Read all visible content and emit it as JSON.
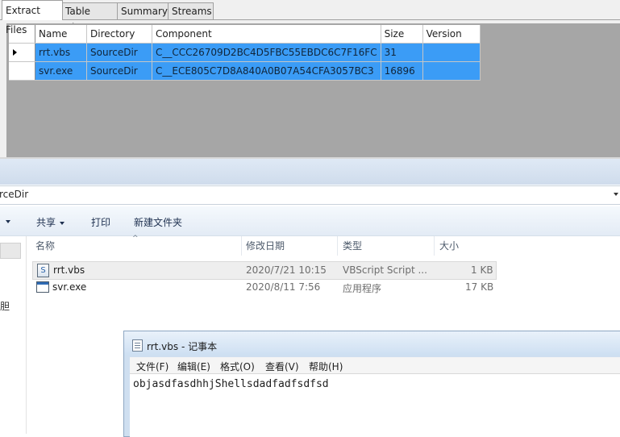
{
  "tool": {
    "tabs": [
      "Extract Files",
      "Table View",
      "Summary",
      "Streams"
    ],
    "grid": {
      "columns": [
        "Name",
        "Directory",
        "Component",
        "Size",
        "Version"
      ],
      "rows": [
        {
          "name": "rrt.vbs",
          "directory": "SourceDir",
          "component": "C__CCC26709D2BC4D5FBC55EBDC6C7F16FC",
          "size": "31",
          "version": ""
        },
        {
          "name": "svr.exe",
          "directory": "SourceDir",
          "component": "C__ECE805C7D8A840A0B07A54CFA3057BC3",
          "size": "16896",
          "version": ""
        }
      ]
    }
  },
  "explorer": {
    "address": "rceDir",
    "toolbar": {
      "organize": "",
      "share": "共享",
      "print": "打印",
      "new_folder": "新建文件夹"
    },
    "columns": {
      "name": "名称",
      "modified": "修改日期",
      "type": "类型",
      "size": "大小"
    },
    "files": [
      {
        "name": "rrt.vbs",
        "modified": "2020/7/21 10:15",
        "type": "VBScript Script ...",
        "size": "1 KB",
        "icon": "vbs-file-icon"
      },
      {
        "name": "svr.exe",
        "modified": "2020/8/11 7:56",
        "type": "应用程序",
        "size": "17 KB",
        "icon": "exe-file-icon"
      }
    ],
    "nav_glyph": "胆"
  },
  "notepad": {
    "title": "rrt.vbs - 记事本",
    "menu": [
      "文件(F)",
      "编辑(E)",
      "格式(O)",
      "查看(V)",
      "帮助(H)"
    ],
    "content": "objasdfasdhhjShellsdadfadfsdfsd"
  },
  "colors": {
    "selection": "#3b9cf6",
    "grid_bg": "#a6a6a6"
  }
}
